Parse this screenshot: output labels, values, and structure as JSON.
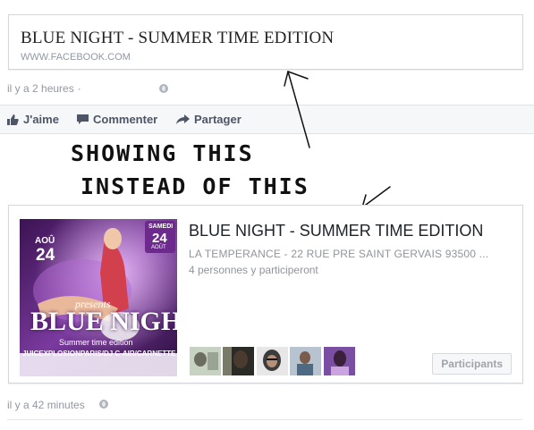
{
  "top_card": {
    "title": "BLUE NIGHT - SUMMER TIME EDITION",
    "domain": "WWW.FACEBOOK.COM"
  },
  "post_meta_top": {
    "time": "il y a 2 heures",
    "separator": "·"
  },
  "actions": {
    "like": "J'aime",
    "comment": "Commenter",
    "share": "Partager"
  },
  "annotations": {
    "line1": "SHOWING THIS",
    "line2": "INSTEAD OF THIS"
  },
  "event": {
    "poster": {
      "month": "AOÛ",
      "day": "24",
      "weekday": "SAMEDI",
      "day_badge": "24",
      "month_badge": "AOÛT",
      "presents": "presents",
      "logo": "BLUE NIGHT",
      "subtitle": "Summer time edition",
      "credits": "JUICEXPLOSIONPARIS/DJ C-AIR/CARNETTE"
    },
    "title": "BLUE NIGHT - SUMMER TIME EDITION",
    "location": "LA TEMPERANCE - 22 RUE PRE SAINT GERVAIS 93500 ...",
    "attending": "4 personnes y participeront",
    "participants_button": "Participants"
  },
  "post_meta_bottom": {
    "time": "il y a 42 minutes"
  },
  "icons": {
    "like": "thumbs-up-icon",
    "comment": "speech-bubble-icon",
    "share": "share-arrow-icon",
    "audience": "globe-icon"
  },
  "colors": {
    "action_text": "#4e5665",
    "meta_text": "#9197a3",
    "poster_purple": "#6b2a8c"
  }
}
